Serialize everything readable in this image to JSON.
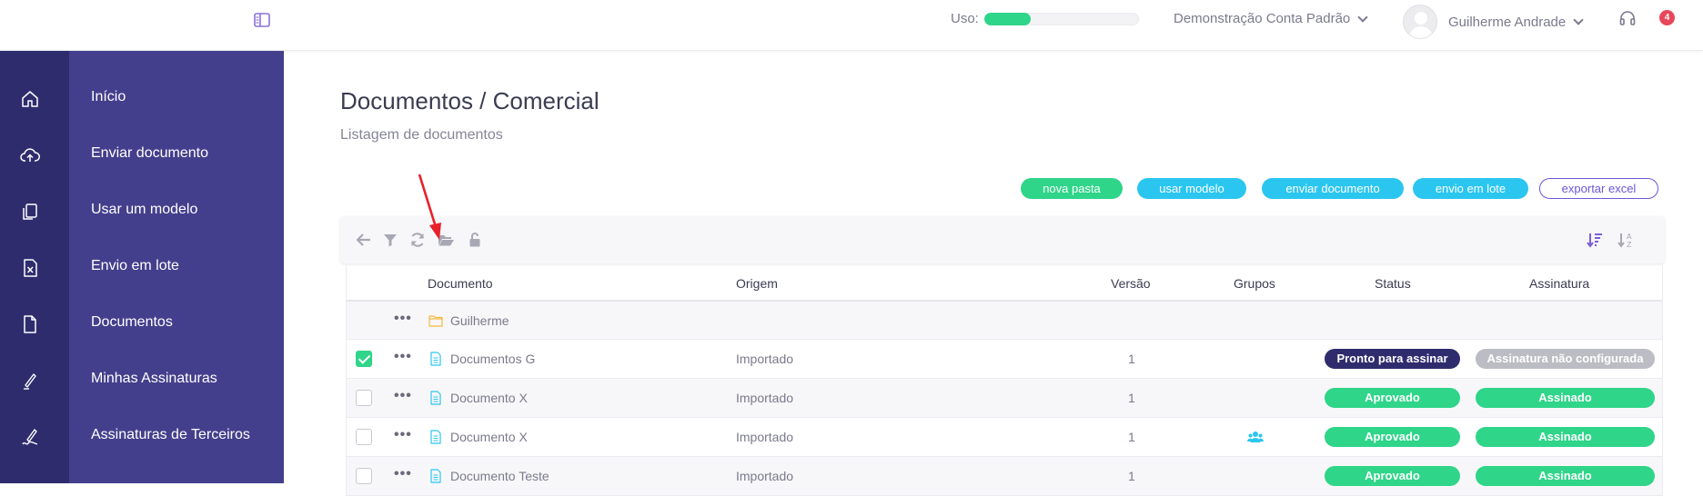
{
  "header": {
    "usage_label": "Uso:",
    "usage_fraction": 0.3,
    "account_name": "Demonstração Conta Padrão",
    "user_name": "Guilherme Andrade",
    "notification_count": "4",
    "icons": [
      "sidebar-toggle-icon",
      "headset-icon",
      "chevron-down-icon",
      "avatar"
    ]
  },
  "sidebar": {
    "items": [
      {
        "label": "Início",
        "icon": "home-icon"
      },
      {
        "label": "Enviar documento",
        "icon": "cloud-upload-icon"
      },
      {
        "label": "Usar um modelo",
        "icon": "template-icon"
      },
      {
        "label": "Envio em lote",
        "icon": "spreadsheet-icon"
      },
      {
        "label": "Documentos",
        "icon": "document-icon"
      },
      {
        "label": "Minhas Assinaturas",
        "icon": "pen-icon"
      },
      {
        "label": "Assinaturas de Terceiros",
        "icon": "signature-icon"
      }
    ]
  },
  "page": {
    "title": "Documentos / Comercial",
    "subtitle": "Listagem de documentos"
  },
  "actions": {
    "new_folder": "nova pasta",
    "use_template": "usar modelo",
    "send_document": "enviar documento",
    "batch_send": "envio em lote",
    "export_excel": "exportar excel"
  },
  "toolbar": {
    "icons": [
      "back-arrow-icon",
      "filter-icon",
      "refresh-icon",
      "folder-open-icon",
      "unlock-icon",
      "sort-descending-icon",
      "sort-alpha-icon"
    ]
  },
  "table": {
    "headers": {
      "documento": "Documento",
      "origem": "Origem",
      "versao": "Versão",
      "grupos": "Grupos",
      "status": "Status",
      "assinatura": "Assinatura"
    },
    "folder_row": {
      "name": "Guilherme"
    },
    "rows": [
      {
        "checked": true,
        "name": "Documentos G",
        "origin": "Importado",
        "version": "1",
        "group": false,
        "status": "Pronto para assinar",
        "signature": "Assinatura não configurada"
      },
      {
        "checked": false,
        "name": "Documento X",
        "origin": "Importado",
        "version": "1",
        "group": false,
        "status": "Aprovado",
        "signature": "Assinado"
      },
      {
        "checked": false,
        "name": "Documento X",
        "origin": "Importado",
        "version": "1",
        "group": true,
        "status": "Aprovado",
        "signature": "Assinado"
      },
      {
        "checked": false,
        "name": "Documento Teste",
        "origin": "Importado",
        "version": "1",
        "group": false,
        "status": "Aprovado",
        "signature": "Assinado"
      }
    ]
  },
  "colors": {
    "sidebar_dark": "#2f2c6e",
    "sidebar": "#443f8c",
    "green": "#2fd589",
    "cyan": "#2bc6f0",
    "purple": "#6a58d6",
    "badge_red": "#e8475b",
    "arrow_red": "#e8202a"
  }
}
